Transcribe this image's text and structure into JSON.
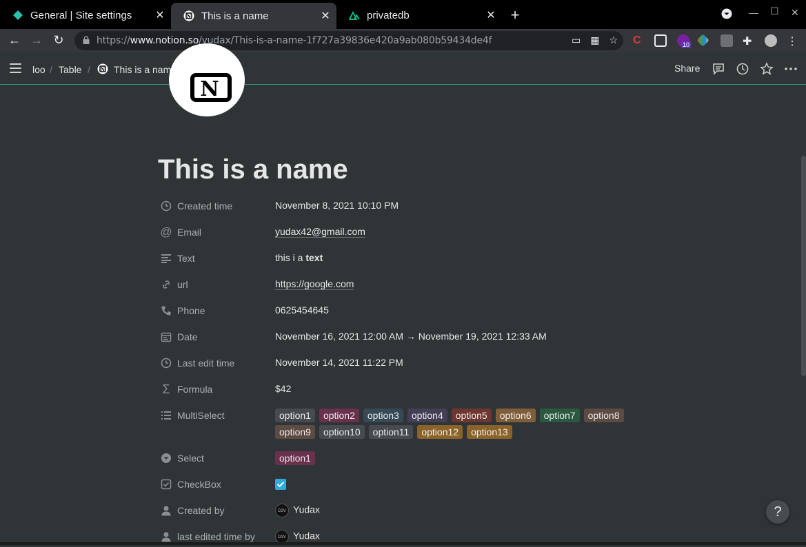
{
  "browser": {
    "tabs": [
      {
        "title": "General | Site settings",
        "icon": "netlify-diamond-icon"
      },
      {
        "title": "This is a name",
        "icon": "notion-icon"
      },
      {
        "title": "privatedb",
        "icon": "nuxt-icon"
      }
    ],
    "new_tab": "+",
    "url_prefix": "https://",
    "url_domain": "www.notion.so",
    "url_path": "/yudax/This-is-a-name-1f727a39836e420a9ab080b59434de4f",
    "extension_badge": "10"
  },
  "notion_topbar": {
    "breadcrumbs": [
      "loo",
      "Table",
      "This is a name"
    ],
    "share_label": "Share"
  },
  "page": {
    "title": "This is a name",
    "properties": [
      {
        "label": "Created time",
        "icon": "clock-icon",
        "value": "November 8, 2021 10:10 PM"
      },
      {
        "label": "Email",
        "icon": "at-icon",
        "value": "yudax42@gmail.com"
      },
      {
        "label": "Text",
        "icon": "text-lines-icon",
        "value": "this i a ",
        "value_bold": "text"
      },
      {
        "label": "url",
        "icon": "link-icon",
        "value": "https://google.com"
      },
      {
        "label": "Phone",
        "icon": "phone-icon",
        "value": "0625454645"
      },
      {
        "label": "Date",
        "icon": "calendar-icon",
        "value": "November 16, 2021 12:00 AM → November 19, 2021 12:33 AM"
      },
      {
        "label": "Last edit time",
        "icon": "clock-icon",
        "value": "November 14, 2021 11:22 PM"
      },
      {
        "label": "Formula",
        "icon": "sigma-icon",
        "value": "$42"
      },
      {
        "label": "MultiSelect",
        "icon": "list-icon"
      },
      {
        "label": "Select",
        "icon": "chevron-circle-icon"
      },
      {
        "label": "CheckBox",
        "icon": "checkbox-icon"
      },
      {
        "label": "Created by",
        "icon": "person-icon",
        "value": "Yudax"
      },
      {
        "label": "last edited time by",
        "icon": "person-icon",
        "value": "Yudax"
      }
    ],
    "multiselect_tags": [
      {
        "label": "option1",
        "color": "#454b4e"
      },
      {
        "label": "option2",
        "color": "#69314c"
      },
      {
        "label": "option3",
        "color": "#364954"
      },
      {
        "label": "option4",
        "color": "#443f57"
      },
      {
        "label": "option5",
        "color": "#6e3630"
      },
      {
        "label": "option6",
        "color": "#805e3a"
      },
      {
        "label": "option7",
        "color": "#2b593f"
      },
      {
        "label": "option8",
        "color": "#5c4b43"
      },
      {
        "label": "option9",
        "color": "#5c4b43"
      },
      {
        "label": "option10",
        "color": "#454b4e"
      },
      {
        "label": "option11",
        "color": "#454b4e"
      },
      {
        "label": "option12",
        "color": "#89632a"
      },
      {
        "label": "option13",
        "color": "#89632a"
      }
    ],
    "select_tag": {
      "label": "option1",
      "color": "#69314c"
    },
    "checkbox_checked": true,
    "avatar_text": "D3V"
  },
  "help_label": "?"
}
